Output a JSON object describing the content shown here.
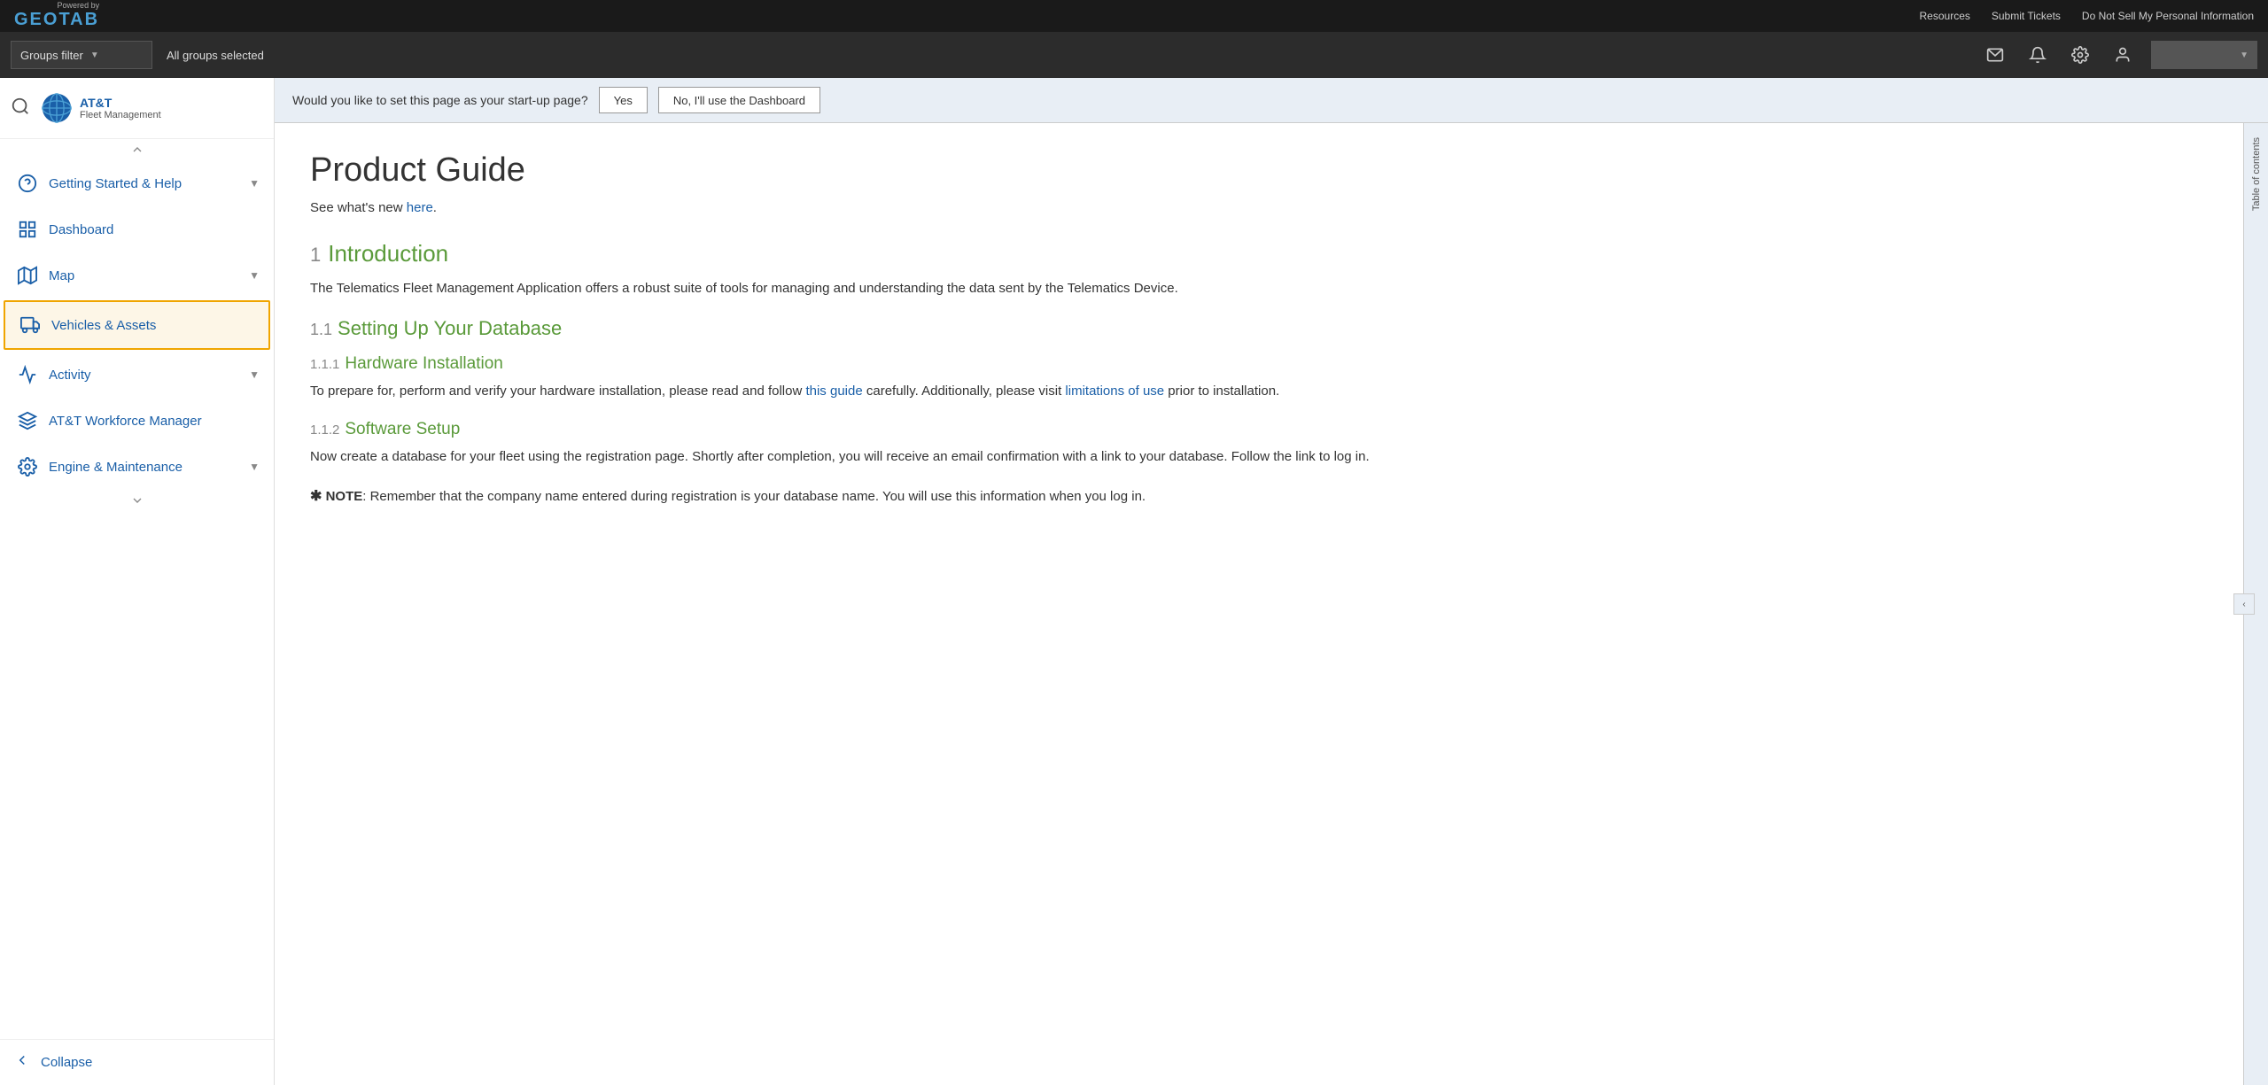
{
  "topbar": {
    "powered_by": "Powered by",
    "logo_text": "GEOTAB",
    "resources_label": "Resources",
    "submit_tickets_label": "Submit Tickets",
    "do_not_sell_label": "Do Not Sell My Personal Information"
  },
  "secondbar": {
    "groups_filter_label": "Groups filter",
    "groups_selected_label": "All groups selected"
  },
  "sidebar": {
    "brand_name": "AT&T",
    "brand_sub": "Fleet Management",
    "collapse_label": "Collapse",
    "nav_items": [
      {
        "id": "getting-started",
        "label": "Getting Started & Help",
        "has_chevron": true,
        "active": false
      },
      {
        "id": "dashboard",
        "label": "Dashboard",
        "has_chevron": false,
        "active": false
      },
      {
        "id": "map",
        "label": "Map",
        "has_chevron": true,
        "active": false
      },
      {
        "id": "vehicles-assets",
        "label": "Vehicles & Assets",
        "has_chevron": false,
        "active": true
      },
      {
        "id": "activity",
        "label": "Activity",
        "has_chevron": true,
        "active": false
      },
      {
        "id": "att-workforce",
        "label": "AT&T Workforce Manager",
        "has_chevron": false,
        "active": false
      },
      {
        "id": "engine-maintenance",
        "label": "Engine & Maintenance",
        "has_chevron": true,
        "active": false
      }
    ]
  },
  "startup_banner": {
    "question": "Would you like to set this page as your start-up page?",
    "yes_label": "Yes",
    "no_label": "No, I'll use the Dashboard"
  },
  "toc": {
    "label": "Table of contents"
  },
  "document": {
    "title": "Product Guide",
    "subtitle_text": "See what's new ",
    "subtitle_link": "here",
    "subtitle_period": ".",
    "sections": [
      {
        "num": "1",
        "title": "Introduction",
        "level": 1,
        "body": "The Telematics Fleet Management Application offers a robust suite of tools for managing and understanding the data sent by the Telematics Device."
      },
      {
        "num": "1.1",
        "title": "Setting Up Your Database",
        "level": 2,
        "body": ""
      },
      {
        "num": "1.1.1",
        "title": "Hardware Installation",
        "level": 3,
        "body_prefix": "To prepare for, perform and verify your hardware installation, please read and follow ",
        "body_link1": "this guide",
        "body_mid": " carefully. Additionally, please visit ",
        "body_link2": "limitations of use",
        "body_suffix": " prior to installation."
      },
      {
        "num": "1.1.2",
        "title": "Software Setup",
        "level": 3,
        "body": "Now create a database for your fleet using the registration page. Shortly after completion, you will receive an email confirmation with a link to your database. Follow the link to log in."
      }
    ],
    "note_star": "✱",
    "note_bold": "NOTE",
    "note_text": ": Remember that the company name entered during registration is your database name. You will use this information when you log in."
  }
}
